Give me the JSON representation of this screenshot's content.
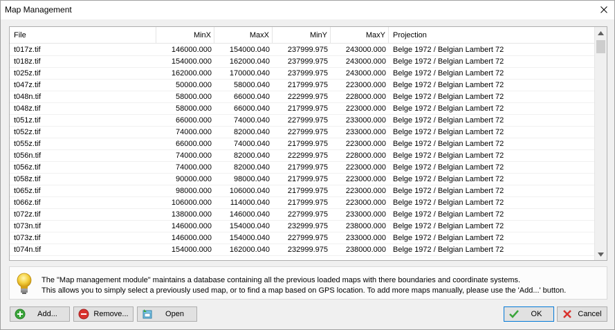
{
  "window": {
    "title": "Map Management"
  },
  "grid": {
    "columns": [
      "File",
      "MinX",
      "MaxX",
      "MinY",
      "MaxY",
      "Projection"
    ],
    "rows": [
      [
        "t017z.tif",
        "146000.000",
        "154000.040",
        "237999.975",
        "243000.000",
        "Belge 1972 / Belgian Lambert 72"
      ],
      [
        "t018z.tif",
        "154000.000",
        "162000.040",
        "237999.975",
        "243000.000",
        "Belge 1972 / Belgian Lambert 72"
      ],
      [
        "t025z.tif",
        "162000.000",
        "170000.040",
        "237999.975",
        "243000.000",
        "Belge 1972 / Belgian Lambert 72"
      ],
      [
        "t047z.tif",
        "50000.000",
        "58000.040",
        "217999.975",
        "223000.000",
        "Belge 1972 / Belgian Lambert 72"
      ],
      [
        "t048n.tif",
        "58000.000",
        "66000.040",
        "222999.975",
        "228000.000",
        "Belge 1972 / Belgian Lambert 72"
      ],
      [
        "t048z.tif",
        "58000.000",
        "66000.040",
        "217999.975",
        "223000.000",
        "Belge 1972 / Belgian Lambert 72"
      ],
      [
        "t051z.tif",
        "66000.000",
        "74000.040",
        "227999.975",
        "233000.000",
        "Belge 1972 / Belgian Lambert 72"
      ],
      [
        "t052z.tif",
        "74000.000",
        "82000.040",
        "227999.975",
        "233000.000",
        "Belge 1972 / Belgian Lambert 72"
      ],
      [
        "t055z.tif",
        "66000.000",
        "74000.040",
        "217999.975",
        "223000.000",
        "Belge 1972 / Belgian Lambert 72"
      ],
      [
        "t056n.tif",
        "74000.000",
        "82000.040",
        "222999.975",
        "228000.000",
        "Belge 1972 / Belgian Lambert 72"
      ],
      [
        "t056z.tif",
        "74000.000",
        "82000.040",
        "217999.975",
        "223000.000",
        "Belge 1972 / Belgian Lambert 72"
      ],
      [
        "t058z.tif",
        "90000.000",
        "98000.040",
        "217999.975",
        "223000.000",
        "Belge 1972 / Belgian Lambert 72"
      ],
      [
        "t065z.tif",
        "98000.000",
        "106000.040",
        "217999.975",
        "223000.000",
        "Belge 1972 / Belgian Lambert 72"
      ],
      [
        "t066z.tif",
        "106000.000",
        "114000.040",
        "217999.975",
        "223000.000",
        "Belge 1972 / Belgian Lambert 72"
      ],
      [
        "t072z.tif",
        "138000.000",
        "146000.040",
        "227999.975",
        "233000.000",
        "Belge 1972 / Belgian Lambert 72"
      ],
      [
        "t073n.tif",
        "146000.000",
        "154000.040",
        "232999.975",
        "238000.000",
        "Belge 1972 / Belgian Lambert 72"
      ],
      [
        "t073z.tif",
        "146000.000",
        "154000.040",
        "227999.975",
        "233000.000",
        "Belge 1972 / Belgian Lambert 72"
      ],
      [
        "t074n.tif",
        "154000.000",
        "162000.040",
        "232999.975",
        "238000.000",
        "Belge 1972 / Belgian Lambert 72"
      ]
    ]
  },
  "info": {
    "line1": "The \"Map management module\" maintains a database containing all the previous loaded maps with there boundaries and coordinate systems.",
    "line2": "This allows you to simply select a previously used map, or to find a map based on GPS location. To add more maps manually, please use  the 'Add...' button."
  },
  "buttons": {
    "add": "Add...",
    "remove": "Remove...",
    "open": "Open",
    "ok": "OK",
    "cancel": "Cancel"
  },
  "icons": {
    "add": "plus-circle-icon",
    "remove": "minus-circle-icon",
    "open": "open-map-icon",
    "ok": "checkmark-icon",
    "cancel": "x-icon",
    "info": "lightbulb-icon"
  },
  "colors": {
    "add_icon": "#3aa53a",
    "remove_icon": "#d9322d",
    "ok_icon": "#3aa53a",
    "cancel_icon": "#d9322d",
    "focus_border": "#0078d7"
  }
}
